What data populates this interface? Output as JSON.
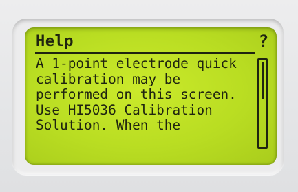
{
  "screen": {
    "title": "Help",
    "help_icon_glyph": "?",
    "body_lines": [
      "A 1-point electrode quick",
      "calibration may be",
      "performed on this screen.",
      "Use HI5036 Calibration",
      "Solution. When the"
    ],
    "scroll_position_fraction": 0.0,
    "scroll_visible_fraction": 0.45
  },
  "colors": {
    "lcd_background": "#bde024",
    "lcd_text": "#1f2410",
    "bezel": "#ececed"
  }
}
